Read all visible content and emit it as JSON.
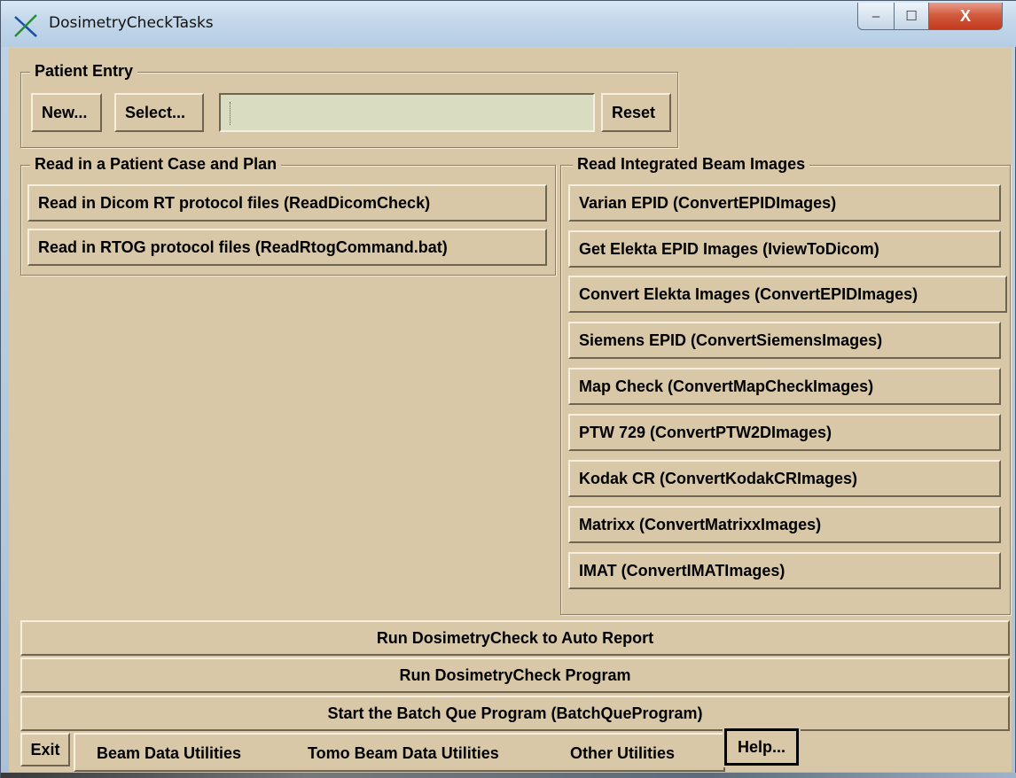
{
  "window": {
    "title": "DosimetryCheckTasks",
    "controls": {
      "minimize": "–",
      "maximize": "☐",
      "close": "X"
    }
  },
  "patient_entry": {
    "legend": "Patient Entry",
    "new_label": "New...",
    "select_label": "Select...",
    "field_value": "",
    "reset_label": "Reset"
  },
  "read_case": {
    "legend": "Read in a Patient Case and Plan",
    "buttons": [
      "Read in Dicom RT protocol files (ReadDicomCheck)",
      "Read in RTOG protocol files (ReadRtogCommand.bat)"
    ]
  },
  "beam_images": {
    "legend": "Read Integrated Beam Images",
    "buttons": [
      "Varian EPID (ConvertEPIDImages)",
      "Get Elekta EPID Images (IviewToDicom)",
      "Convert Elekta Images (ConvertEPIDImages)",
      "Siemens EPID (ConvertSiemensImages)",
      "Map Check (ConvertMapCheckImages)",
      "PTW 729 (ConvertPTW2DImages)",
      "Kodak CR (ConvertKodakCRImages)",
      "Matrixx (ConvertMatrixxImages)",
      "IMAT (ConvertIMATImages)"
    ]
  },
  "actions": {
    "auto_report": "Run DosimetryCheck to Auto Report",
    "run_program": "Run DosimetryCheck Program",
    "batch_que": "Start the Batch Que Program (BatchQueProgram)"
  },
  "bottom_bar": {
    "exit": "Exit",
    "menus": [
      "Beam Data Utilities",
      "Tomo Beam Data Utilities",
      "Other Utilities"
    ],
    "help": "Help..."
  },
  "colors": {
    "panel": "#d8c8a8",
    "entry_field": "#d9dcc1",
    "close_button": "#c8472a"
  }
}
